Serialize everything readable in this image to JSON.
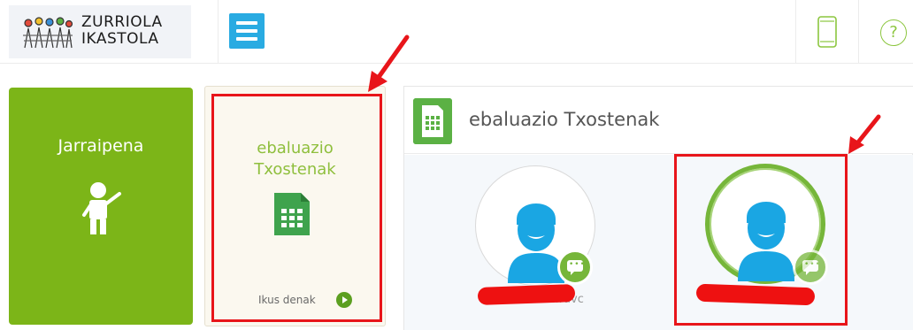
{
  "header": {
    "logo": {
      "line1": "ZURRIOLA",
      "line2": "IKASTOLA",
      "icon": "school-logo-icon"
    },
    "menu_icon": "hamburger-menu-icon",
    "mobile_icon": "mobile-phone-icon",
    "help_icon": "help-icon",
    "help_glyph": "?"
  },
  "tiles": [
    {
      "title": "Jarraipena",
      "icon": "teacher-icon",
      "color": "#7cb518"
    },
    {
      "title_line1": "ebaluazio",
      "title_line2": "Txostenak",
      "icon": "spreadsheet-icon",
      "see_all": "Ikus denak",
      "see_all_icon": "play-circle-icon"
    }
  ],
  "panel": {
    "title": "ebaluazio Txostenak",
    "icon": "spreadsheet-icon",
    "students": [
      {
        "avatar_icon": "student-avatar-icon",
        "badge_icon": "chat-bubble-icon",
        "name_visible": "mTravc",
        "name_redacted": true
      },
      {
        "avatar_icon": "student-avatar-icon",
        "badge_icon": "chat-bubble-icon",
        "name_visible": "",
        "name_redacted": true,
        "selected": true
      }
    ]
  },
  "annotations": {
    "highlight_color": "#e8151a",
    "arrows": 2
  },
  "colors": {
    "brand_green": "#7cb518",
    "accent_blue": "#29abe2",
    "badge_green": "#76b63a",
    "avatar_blue": "#1aa6e3"
  }
}
